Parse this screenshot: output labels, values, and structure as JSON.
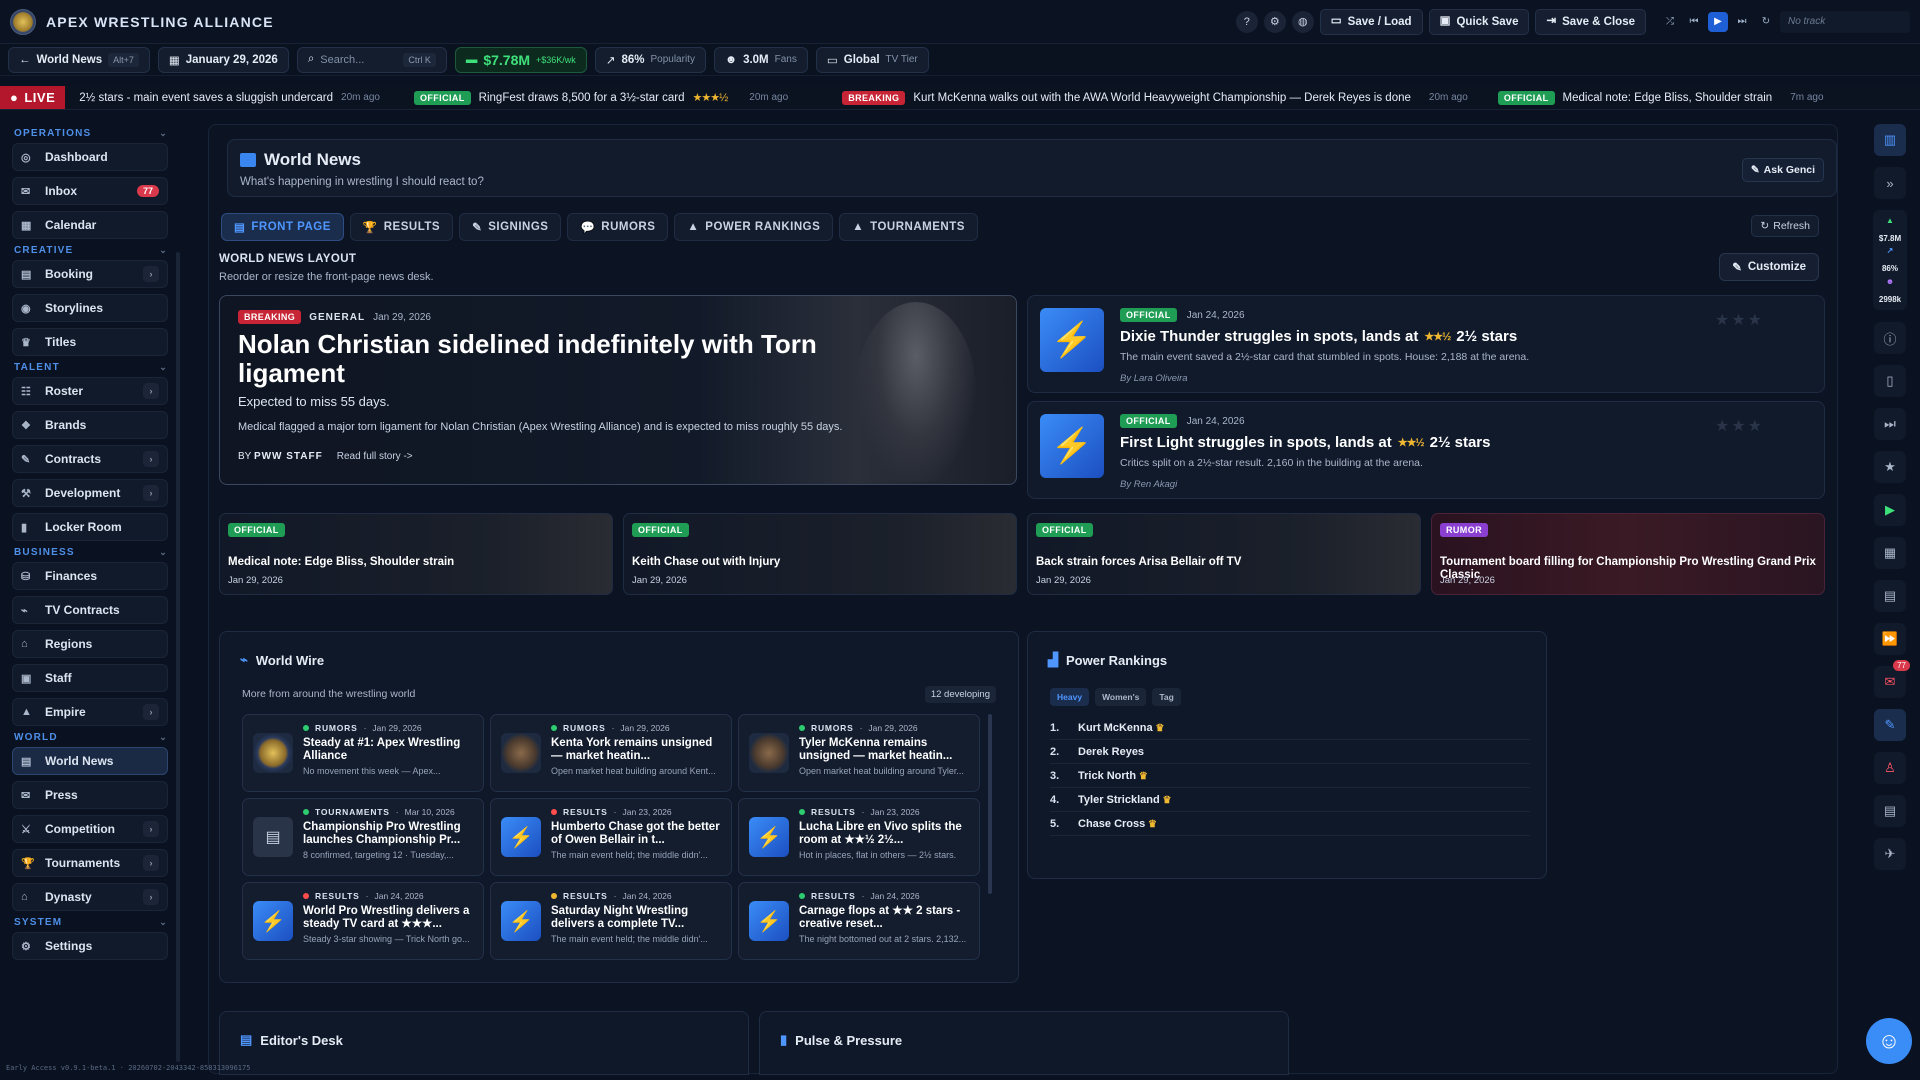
{
  "app": {
    "title": "APEX WRESTLING ALLIANCE",
    "version": "Early Access v0.9.1-beta.1 · 20260702-2043342-858313096175"
  },
  "topbar": {
    "save_load": "Save / Load",
    "quick_save": "Quick Save",
    "save_close": "Save & Close",
    "track": "No track",
    "icons": [
      "help-icon",
      "settings-icon",
      "globe-icon"
    ]
  },
  "subbar": {
    "back_label": "World News",
    "back_shortcut": "Alt+7",
    "date": "January 29, 2026",
    "search_placeholder": "Search...",
    "search_shortcut": "Ctrl K",
    "money": "$7.78M",
    "money_delta": "+$36K/wk",
    "popularity": "86%",
    "popularity_label": "Popularity",
    "fans": "3.0M",
    "fans_label": "Fans",
    "tier": "Global",
    "tier_label": "TV Tier"
  },
  "ticker": {
    "live": "LIVE",
    "items": [
      {
        "badge": "",
        "text": "2½ stars - main event saves a sluggish undercard",
        "ago": "20m ago",
        "stars": ""
      },
      {
        "badge": "OFFICIAL",
        "text": "RingFest draws 8,500 for a 3½-star card",
        "ago": "20m ago",
        "stars": "★★★½"
      },
      {
        "badge": "BREAKING",
        "text": "Kurt McKenna walks out with the AWA World Heavyweight Championship — Derek Reyes is done",
        "ago": "20m ago",
        "stars": ""
      },
      {
        "badge": "OFFICIAL",
        "text": "Medical note: Edge Bliss, Shoulder strain",
        "ago": "7m ago",
        "stars": ""
      }
    ]
  },
  "sidebar": {
    "sections": [
      {
        "title": "OPERATIONS",
        "items": [
          {
            "label": "Dashboard",
            "icon": "◎",
            "arrow": false,
            "count": ""
          },
          {
            "label": "Inbox",
            "icon": "✉",
            "arrow": false,
            "count": "77"
          },
          {
            "label": "Calendar",
            "icon": "▦",
            "arrow": false,
            "count": ""
          }
        ]
      },
      {
        "title": "CREATIVE",
        "items": [
          {
            "label": "Booking",
            "icon": "▤",
            "arrow": true,
            "count": ""
          },
          {
            "label": "Storylines",
            "icon": "◉",
            "arrow": false,
            "count": ""
          },
          {
            "label": "Titles",
            "icon": "♛",
            "arrow": false,
            "count": ""
          }
        ]
      },
      {
        "title": "TALENT",
        "items": [
          {
            "label": "Roster",
            "icon": "☷",
            "arrow": true,
            "count": ""
          },
          {
            "label": "Brands",
            "icon": "❖",
            "arrow": false,
            "count": ""
          },
          {
            "label": "Contracts",
            "icon": "✎",
            "arrow": true,
            "count": ""
          },
          {
            "label": "Development",
            "icon": "⚒",
            "arrow": true,
            "count": ""
          },
          {
            "label": "Locker Room",
            "icon": "▮",
            "arrow": false,
            "count": ""
          }
        ]
      },
      {
        "title": "BUSINESS",
        "items": [
          {
            "label": "Finances",
            "icon": "⛁",
            "arrow": false,
            "count": ""
          },
          {
            "label": "TV Contracts",
            "icon": "⌁",
            "arrow": false,
            "count": ""
          },
          {
            "label": "Regions",
            "icon": "⌂",
            "arrow": false,
            "count": ""
          },
          {
            "label": "Staff",
            "icon": "▣",
            "arrow": false,
            "count": ""
          },
          {
            "label": "Empire",
            "icon": "▲",
            "arrow": true,
            "count": ""
          }
        ]
      },
      {
        "title": "WORLD",
        "items": [
          {
            "label": "World News",
            "icon": "▤",
            "arrow": false,
            "count": "",
            "active": true
          },
          {
            "label": "Press",
            "icon": "✉",
            "arrow": false,
            "count": ""
          },
          {
            "label": "Competition",
            "icon": "⚔",
            "arrow": true,
            "count": ""
          },
          {
            "label": "Tournaments",
            "icon": "🏆",
            "arrow": true,
            "count": ""
          },
          {
            "label": "Dynasty",
            "icon": "⌂",
            "arrow": true,
            "count": ""
          }
        ]
      },
      {
        "title": "SYSTEM",
        "items": [
          {
            "label": "Settings",
            "icon": "⚙",
            "arrow": false,
            "count": ""
          }
        ]
      }
    ]
  },
  "main": {
    "title": "World News",
    "subtitle": "What's happening in wrestling I should react to?",
    "ask_label": "Ask Genci",
    "tabs": [
      "FRONT PAGE",
      "RESULTS",
      "SIGNINGS",
      "RUMORS",
      "POWER RANKINGS",
      "TOURNAMENTS"
    ],
    "tab_icons": [
      "▤",
      "🏆",
      "✎",
      "💬",
      "▲",
      "▲"
    ],
    "refresh_label": "Refresh",
    "layout_title": "WORLD NEWS LAYOUT",
    "layout_sub": "Reorder or resize the front-page news desk.",
    "customize_label": "Customize",
    "hero": {
      "badge": "BREAKING",
      "category": "GENERAL",
      "date": "Jan 29, 2026",
      "title": "Nolan Christian sidelined indefinitely with Torn ligament",
      "expected": "Expected to miss 55 days.",
      "body": "Medical flagged a major torn ligament for Nolan Christian (Apex Wrestling Alliance) and is expected to miss roughly 55 days.",
      "by": "PWW STAFF",
      "read_more": "Read full story ->"
    },
    "side_stories": [
      {
        "badge": "OFFICIAL",
        "date": "Jan 24, 2026",
        "title_a": "Dixie Thunder struggles in spots, lands at",
        "stars": "★★½",
        "title_b": "2½ stars",
        "desc": "The main event saved a 2½-star card that stumbled in spots. House: 2,188 at the arena.",
        "by": "By Lara Oliveira"
      },
      {
        "badge": "OFFICIAL",
        "date": "Jan 24, 2026",
        "title_a": "First Light struggles in spots, lands at",
        "stars": "★★½",
        "title_b": "2½ stars",
        "desc": "Critics split on a 2½-star result. 2,160 in the building at the arena.",
        "by": "By Ren Akagi"
      }
    ],
    "cards": [
      {
        "badge": "OFFICIAL",
        "title": "Medical note: Edge Bliss, Shoulder strain",
        "date": "Jan 29, 2026"
      },
      {
        "badge": "OFFICIAL",
        "title": "Keith Chase out with Injury",
        "date": "Jan 29, 2026"
      },
      {
        "badge": "OFFICIAL",
        "title": "Back strain forces Arisa Bellair off TV",
        "date": "Jan 29, 2026"
      },
      {
        "badge": "RUMOR",
        "title": "Tournament board filling for Championship Pro Wrestling Grand Prix Classic",
        "date": "Jan 29, 2026"
      }
    ],
    "wire": {
      "title": "World Wire",
      "sub": "More from around the wrestling world",
      "developing": "12 developing",
      "items": [
        {
          "cat": "RUMORS",
          "date": "Jan 29, 2026",
          "title": "Steady at #1: Apex Wrestling Alliance",
          "sum": "No movement this week — Apex...",
          "thumb": "lg",
          "dot": "#2ecc71"
        },
        {
          "cat": "RUMORS",
          "date": "Jan 29, 2026",
          "title": "Kenta York remains unsigned — market heatin...",
          "sum": "Open market heat building around Kent...",
          "thumb": "ph",
          "dot": "#2ecc71"
        },
        {
          "cat": "RUMORS",
          "date": "Jan 29, 2026",
          "title": "Tyler McKenna remains unsigned — market heatin...",
          "sum": "Open market heat building around Tyler...",
          "thumb": "ph",
          "dot": "#2ecc71"
        },
        {
          "cat": "TOURNAMENTS",
          "date": "Mar 10, 2026",
          "title": "Championship Pro Wrestling launches Championship Pr...",
          "sum": "8 confirmed, targeting 12 · Tuesday,...",
          "thumb": "nw",
          "dot": "#2ecc71"
        },
        {
          "cat": "RESULTS",
          "date": "Jan 23, 2026",
          "title": "Humberto Chase got the better of Owen Bellair in t...",
          "sum": "The main event held; the middle didn'...",
          "thumb": "bl",
          "dot": "#ff4d4d"
        },
        {
          "cat": "RESULTS",
          "date": "Jan 23, 2026",
          "title": "Lucha Libre en Vivo splits the room at ★★½ 2½...",
          "sum": "Hot in places, flat in others — 2½ stars.",
          "thumb": "bl",
          "dot": "#2ecc71"
        },
        {
          "cat": "RESULTS",
          "date": "Jan 24, 2026",
          "title": "World Pro Wrestling delivers a steady TV card at ★★★...",
          "sum": "Steady 3-star showing — Trick North go...",
          "thumb": "bl",
          "dot": "#ff4d4d"
        },
        {
          "cat": "RESULTS",
          "date": "Jan 24, 2026",
          "title": "Saturday Night Wrestling delivers a complete TV...",
          "sum": "The main event held; the middle didn'...",
          "thumb": "bl",
          "dot": "#f0b731"
        },
        {
          "cat": "RESULTS",
          "date": "Jan 24, 2026",
          "title": "Carnage flops at ★★ 2 stars - creative reset...",
          "sum": "The night bottomed out at 2 stars. 2,132...",
          "thumb": "bl",
          "dot": "#2ecc71"
        }
      ]
    },
    "rankings": {
      "title": "Power Rankings",
      "tabs": [
        "Heavy",
        "Women's",
        "Tag"
      ],
      "list": [
        {
          "num": "1.",
          "name": "Kurt McKenna",
          "crown": true
        },
        {
          "num": "2.",
          "name": "Derek Reyes",
          "crown": false
        },
        {
          "num": "3.",
          "name": "Trick North",
          "crown": true
        },
        {
          "num": "4.",
          "name": "Tyler Strickland",
          "crown": true
        },
        {
          "num": "5.",
          "name": "Chase Cross",
          "crown": true
        }
      ]
    },
    "editor_title": "Editor's Desk",
    "pulse_title": "Pulse & Pressure"
  },
  "rail": {
    "stats": [
      "$7.8M",
      "86%",
      "2998k"
    ],
    "inbox_count": "77"
  }
}
